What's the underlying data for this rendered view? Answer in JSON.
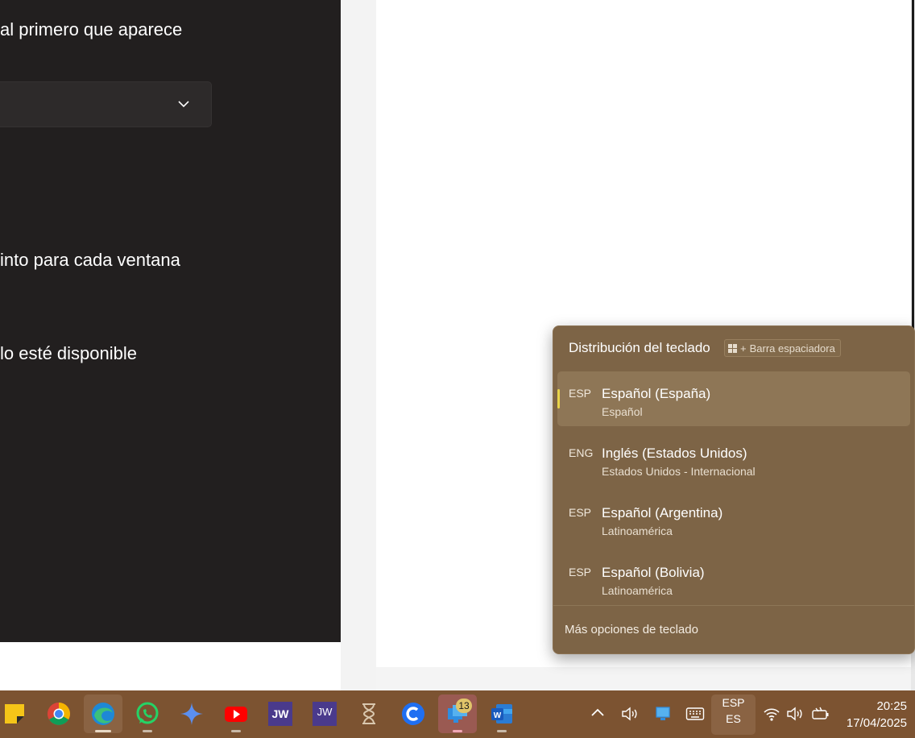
{
  "settings": {
    "line1": "al primero que aparece",
    "line2": "into para cada ventana",
    "line3": "lo esté disponible"
  },
  "flyout": {
    "title": "Distribución del teclado",
    "shortcut_plus": "+",
    "shortcut_label": "Barra espaciadora",
    "items": [
      {
        "code": "ESP",
        "name": "Español (España)",
        "layout": "Español",
        "selected": true
      },
      {
        "code": "ENG",
        "name": "Inglés (Estados Unidos)",
        "layout": "Estados Unidos - Internacional",
        "selected": false
      },
      {
        "code": "ESP",
        "name": "Español (Argentina)",
        "layout": "Latinoamérica",
        "selected": false
      },
      {
        "code": "ESP",
        "name": "Español (Bolivia)",
        "layout": "Latinoamérica",
        "selected": false
      }
    ],
    "more_options": "Más opciones de teclado"
  },
  "taskbar": {
    "apps": [
      {
        "name": "sticky-notes-icon",
        "label": ""
      },
      {
        "name": "chrome-icon",
        "label": ""
      },
      {
        "name": "edge-icon",
        "label": ""
      },
      {
        "name": "whatsapp-icon",
        "label": ""
      },
      {
        "name": "copilot-icon",
        "label": ""
      },
      {
        "name": "youtube-icon",
        "label": ""
      },
      {
        "name": "jw-icon",
        "label": "JW"
      },
      {
        "name": "jw-library-icon",
        "label": "JW"
      },
      {
        "name": "hourglass-icon",
        "label": ""
      },
      {
        "name": "c-app-icon",
        "label": ""
      },
      {
        "name": "remote-desktop-icon",
        "label": ""
      },
      {
        "name": "word-icon",
        "label": "W"
      }
    ],
    "badge_count": "13",
    "tray_language_top": "ESP",
    "tray_language_bottom": "ES",
    "time": "20:25",
    "date": "17/04/2025"
  },
  "colors": {
    "flyout_bg": "#7d6446",
    "taskbar_bg": "#7c5331",
    "selection_accent": "#e8d44a",
    "dark_window_bg": "#221f1f"
  }
}
